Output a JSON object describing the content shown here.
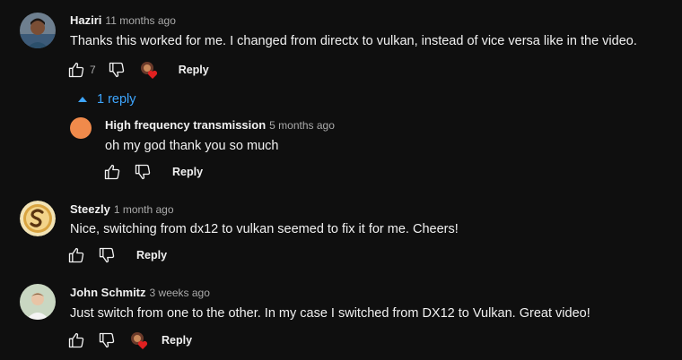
{
  "comments": [
    {
      "author": "Haziri",
      "time": "11 months ago",
      "text": "Thanks this worked for me. I changed from directx to vulkan, instead of vice versa like in the video.",
      "likes": "7",
      "reply_label": "Reply",
      "creator_heart": true
    },
    {
      "author": "Steezly",
      "time": "1 month ago",
      "text": "Nice, switching from dx12 to vulkan seemed to fix it for me. Cheers!",
      "reply_label": "Reply",
      "creator_heart": false
    },
    {
      "author": "John Schmitz",
      "time": "3 weeks ago",
      "text": "Just switch from one to the other. In my case I switched from DX12 to Vulkan. Great video!",
      "reply_label": "Reply",
      "creator_heart": true
    }
  ],
  "replies_toggle": {
    "label": "1 reply",
    "color": "#3ea6ff"
  },
  "reply": {
    "author": "High frequency transmission",
    "time": "5 months ago",
    "text": "oh my god thank you so much",
    "reply_label": "Reply",
    "avatar_color": "#f08a4b"
  },
  "colors": {
    "background": "#0f0f0f",
    "text": "#f1f1f1",
    "secondary": "#aaaaaa",
    "heart": "#e02020"
  }
}
